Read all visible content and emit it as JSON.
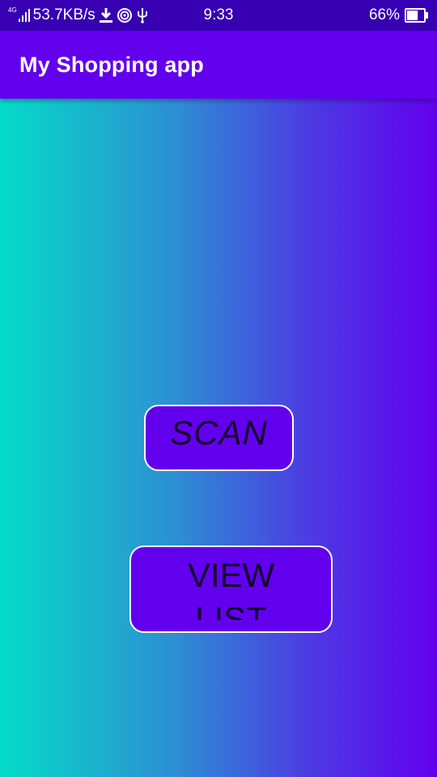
{
  "status_bar": {
    "network_type": "4G",
    "speed": "53.7KB/s",
    "time": "9:33",
    "battery": "66%",
    "icons": [
      "signal-icon",
      "download-icon",
      "hotspot-icon",
      "usb-icon",
      "battery-icon"
    ],
    "battery_level": 0.66
  },
  "app_bar": {
    "title": "My Shopping app"
  },
  "buttons": {
    "scan_label": "SCAN",
    "view_list_label": "VIEW LIST"
  },
  "colors": {
    "status_bar": "#3700B3",
    "primary": "#6200EE",
    "gradient_start": "#05DBC8",
    "gradient_end": "#6200EE",
    "button_text": "#14002B",
    "button_border": "#FFFFFF"
  }
}
